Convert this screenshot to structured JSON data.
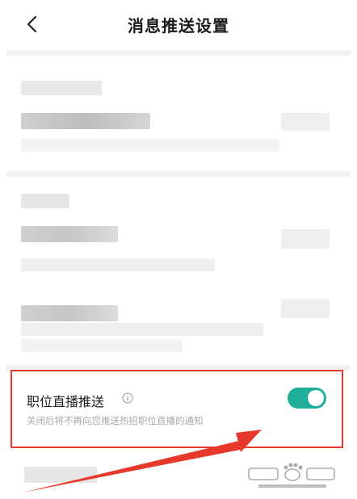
{
  "header": {
    "title": "消息推送设置",
    "back_icon": "chevron-left-icon"
  },
  "live_push_setting": {
    "title": "职位直播推送",
    "description": "关闭后将不再向您推送热招职位直播的通知",
    "enabled": true,
    "info_icon": "info-circle-icon"
  },
  "colors": {
    "toggle_on": "#1fae9a",
    "highlight_border": "#e8392d",
    "annotation_arrow": "#e8392d",
    "divider": "#f2f2f2"
  }
}
